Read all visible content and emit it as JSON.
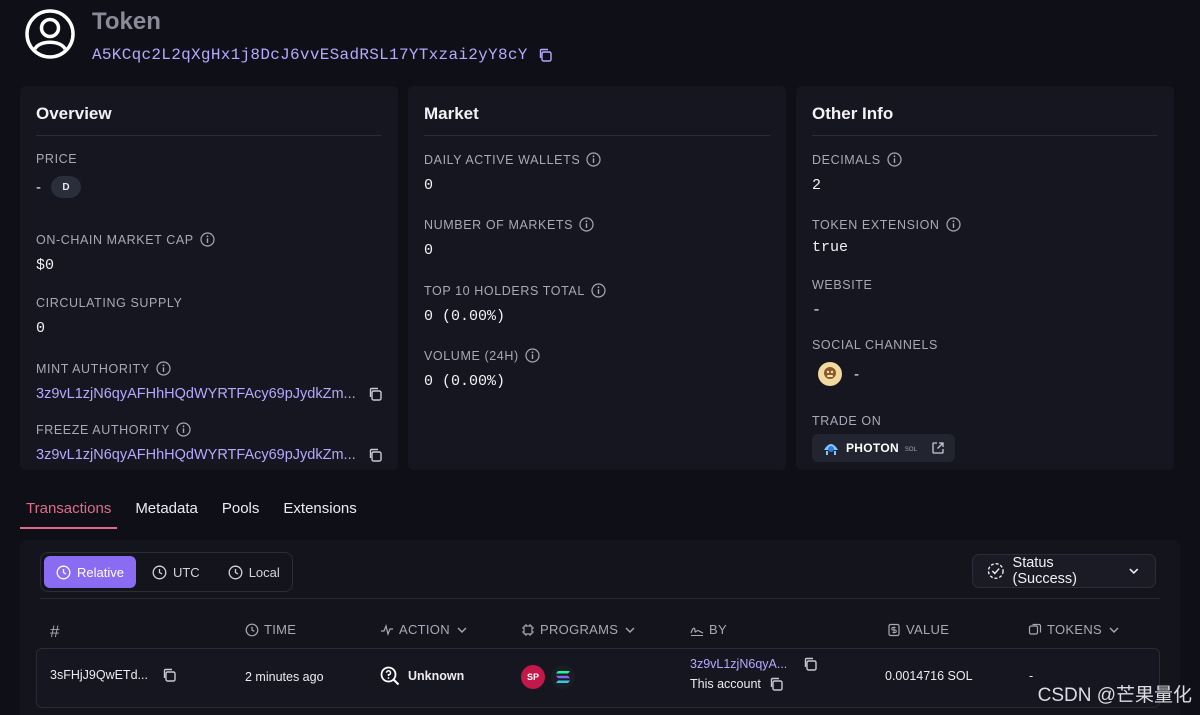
{
  "header": {
    "title": "Token",
    "address": "A5KCqc2L2qXgHx1j8DcJ6vvESadRSL17YTxzai2yY8cY"
  },
  "overview": {
    "title": "Overview",
    "price_label": "PRICE",
    "price_value": "-",
    "price_badge": "D",
    "market_cap_label": "ON-CHAIN MARKET CAP",
    "market_cap_value": "$0",
    "supply_label": "CIRCULATING SUPPLY",
    "supply_value": "0",
    "mint_label": "MINT AUTHORITY",
    "mint_value": "3z9vL1zjN6qyAFHhHQdWYRTFAcy69pJydkZm...",
    "freeze_label": "FREEZE AUTHORITY",
    "freeze_value": "3z9vL1zjN6qyAFHhHQdWYRTFAcy69pJydkZm..."
  },
  "market": {
    "title": "Market",
    "daw_label": "DAILY ACTIVE WALLETS",
    "daw_value": "0",
    "markets_label": "NUMBER OF MARKETS",
    "markets_value": "0",
    "holders_label": "TOP 10 HOLDERS TOTAL",
    "holders_value": "0 (0.00%)",
    "volume_label": "VOLUME (24H)",
    "volume_value": "0 (0.00%)"
  },
  "other": {
    "title": "Other Info",
    "decimals_label": "DECIMALS",
    "decimals_value": "2",
    "extension_label": "TOKEN EXTENSION",
    "extension_value": "true",
    "website_label": "WEBSITE",
    "website_value": "-",
    "social_label": "SOCIAL CHANNELS",
    "social_value": "-",
    "trade_label": "TRADE ON",
    "trade_name": "PHOTON",
    "trade_sub": "SOL"
  },
  "tabs": [
    "Transactions",
    "Metadata",
    "Pools",
    "Extensions"
  ],
  "toggles": [
    "Relative",
    "UTC",
    "Local"
  ],
  "status_filter": "Status (Success)",
  "columns": [
    "#",
    "TIME",
    "ACTION",
    "PROGRAMS",
    "BY",
    "VALUE",
    "TOKENS"
  ],
  "row": {
    "signature": "3sFHjJ9QwETd...",
    "time": "2 minutes ago",
    "action": "Unknown",
    "program_badge": "SP",
    "by": "3z9vL1zjN6qyA...",
    "by_note": "This account",
    "value": "0.0014716 SOL",
    "tokens": "-"
  },
  "watermark": "CSDN @芒果量化",
  "colors": {
    "background": "#0f1017",
    "card": "#15161f",
    "link": "#b6a8ff",
    "accent_tab": "#e06b8b",
    "toggle_active": "#8a6cf2"
  }
}
